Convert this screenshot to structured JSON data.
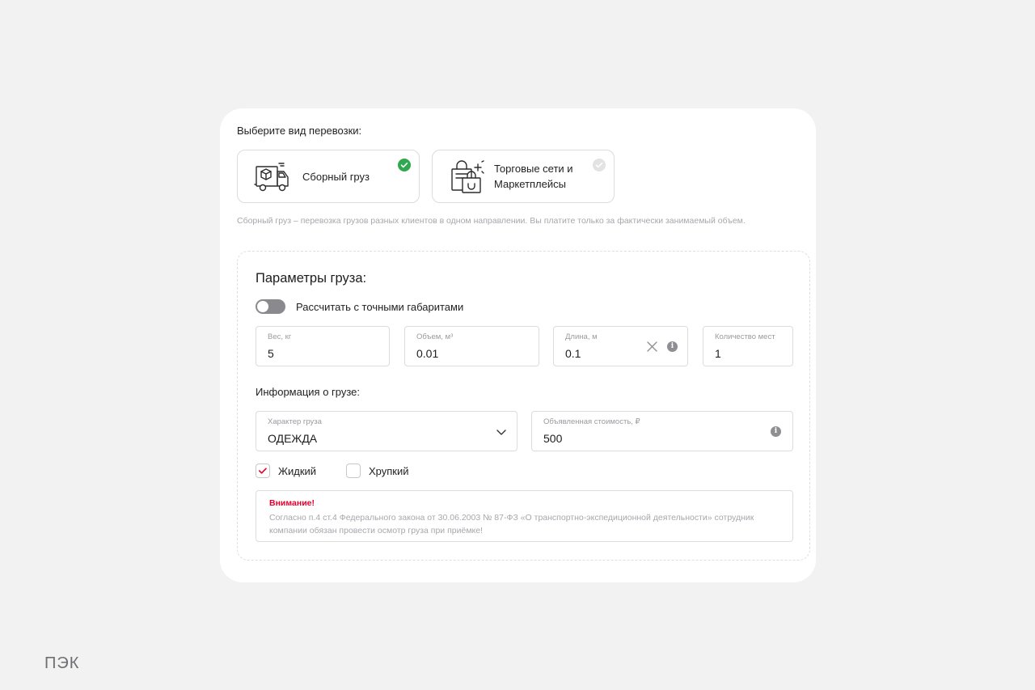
{
  "transport": {
    "title": "Выберите вид перевозки:",
    "options": [
      {
        "label": "Сборный груз",
        "icon": "delivery-truck-icon",
        "selected": true
      },
      {
        "label": "Торговые сети и Маркетплейсы",
        "icon": "shopping-bags-icon",
        "selected": false
      }
    ],
    "description": "Сборный груз – перевозка грузов разных клиентов в одном направлении. Вы платите только за фактически занимаемый объем."
  },
  "params": {
    "title": "Параметры груза:",
    "toggle_label": "Рассчитать с точными габаритами",
    "toggle_on": false,
    "fields": {
      "weight": {
        "label": "Вес, кг",
        "value": "5"
      },
      "volume": {
        "label": "Объем, м³",
        "value": "0.01"
      },
      "length": {
        "label": "Длина, м",
        "value": "0.1"
      },
      "places": {
        "label": "Количество мест",
        "value": "1"
      }
    }
  },
  "cargo": {
    "title": "Информация о грузе:",
    "type": {
      "label": "Характер груза",
      "value": "ОДЕЖДА"
    },
    "cost": {
      "label": "Объявленная стоимость, ₽",
      "value": "500"
    },
    "checkboxes": [
      {
        "label": "Жидкий",
        "checked": true
      },
      {
        "label": "Хрупкий",
        "checked": false
      }
    ]
  },
  "warning": {
    "title": "Внимание!",
    "text": "Согласно п.4 ст.4 Федерального закона от 30.06.2003 № 87-ФЗ «О транспортно-экспедиционной деятельности» сотрудник компании обязан провести осмотр груза при приёмке!"
  },
  "brand": "ПЭК",
  "colors": {
    "accent": "#e4002b",
    "success": "#2fa84f",
    "background": "#f2f2f2"
  }
}
